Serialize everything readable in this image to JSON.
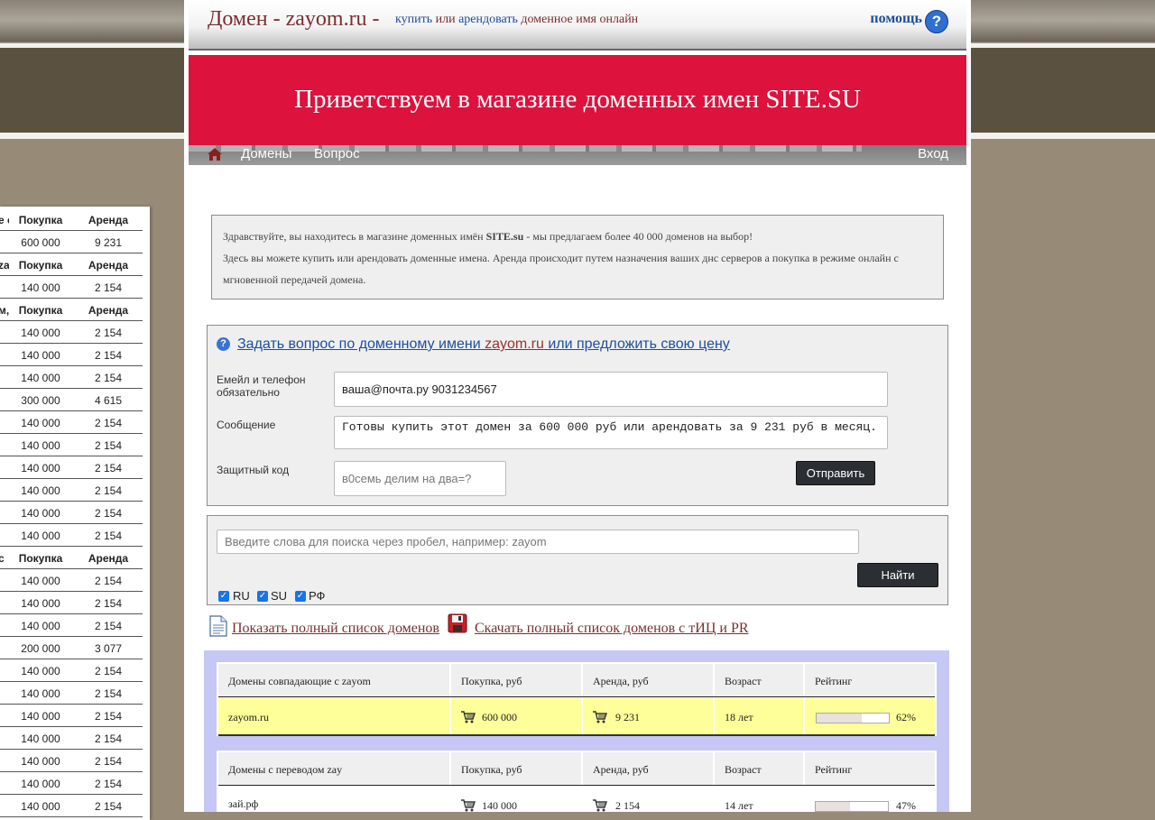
{
  "header": {
    "title": "Домен - zayom.ru -",
    "tagline_buy": "купить",
    "tagline_or": "или",
    "tagline_rent": "арендовать",
    "tagline_rest": "доменное имя онлайн",
    "help_label": "помощь",
    "help_icon": "question-mark-icon"
  },
  "banner": {
    "text": "Приветствуем в магазине доменных имен SITE.SU",
    "color": "#dd123d"
  },
  "nav": {
    "home_icon": "home-icon",
    "items": [
      "Домены",
      "Вопрос"
    ],
    "login": "Вход"
  },
  "intro": {
    "line1_a": "Здравствуйте, вы находитесь в магазине доменных имён",
    "line1_b": "SITE.su",
    "line1_c": "- мы предлагаем более 40 000 доменов на выбор!",
    "line2": "Здесь вы можете купить или арендовать доменные имена. Аренда происходит путем назначения ваших днс серверов а покупка в режиме онлайн с",
    "line3": "мгновенной передачей домена."
  },
  "question_form": {
    "title_a": "Задать вопрос по доменному имени",
    "title_z": "z",
    "title_domain": "ayom.ru",
    "title_b": "или предложить свою цену",
    "email_label": "Емейл и телефон обязательно",
    "email_value": "ваша@почта.ру 9031234567",
    "message_label": "Сообщение",
    "message_value": "Готовы купить этот домен за 600 000 руб или арендовать за 9 231 руб в месяц.",
    "captcha_label": "Защитный код",
    "captcha_placeholder": "в0семь делим на два=?",
    "submit_label": "Отправить"
  },
  "search": {
    "placeholder": "Введите слова для поиска через пробел, например: zayom",
    "button_label": "Найти",
    "zones": [
      {
        "label": "RU",
        "checked": true
      },
      {
        "label": "SU",
        "checked": true
      },
      {
        "label": "РФ",
        "checked": true
      }
    ]
  },
  "links": {
    "full_list": "Показать полный список доменов",
    "download": "Скачать полный список доменов с тИЦ и PR"
  },
  "left_table": {
    "rows": [
      {
        "c0": "е с",
        "c1": "Покупка",
        "c2": "Аренда",
        "header": true
      },
      {
        "c0": "",
        "c1": "600 000",
        "c2": "9 231"
      },
      {
        "c0": "za",
        "c1": "Покупка",
        "c2": "Аренда",
        "header": true
      },
      {
        "c0": "",
        "c1": "140 000",
        "c2": "2 154"
      },
      {
        "c0": "м,",
        "c1": "Покупка",
        "c2": "Аренда",
        "header": true
      },
      {
        "c0": "",
        "c1": "140 000",
        "c2": "2 154"
      },
      {
        "c0": "",
        "c1": "140 000",
        "c2": "2 154"
      },
      {
        "c0": "",
        "c1": "140 000",
        "c2": "2 154"
      },
      {
        "c0": "",
        "c1": "300 000",
        "c2": "4 615"
      },
      {
        "c0": "",
        "c1": "140 000",
        "c2": "2 154"
      },
      {
        "c0": "",
        "c1": "140 000",
        "c2": "2 154"
      },
      {
        "c0": "",
        "c1": "140 000",
        "c2": "2 154"
      },
      {
        "c0": "",
        "c1": "140 000",
        "c2": "2 154"
      },
      {
        "c0": "",
        "c1": "140 000",
        "c2": "2 154"
      },
      {
        "c0": "",
        "c1": "140 000",
        "c2": "2 154"
      },
      {
        "c0": "с",
        "c1": "Покупка",
        "c2": "Аренда",
        "header": true
      },
      {
        "c0": "",
        "c1": "140 000",
        "c2": "2 154"
      },
      {
        "c0": "",
        "c1": "140 000",
        "c2": "2 154"
      },
      {
        "c0": "",
        "c1": "140 000",
        "c2": "2 154"
      },
      {
        "c0": "",
        "c1": "200 000",
        "c2": "3 077"
      },
      {
        "c0": "",
        "c1": "140 000",
        "c2": "2 154"
      },
      {
        "c0": "",
        "c1": "140 000",
        "c2": "2 154"
      },
      {
        "c0": "",
        "c1": "140 000",
        "c2": "2 154"
      },
      {
        "c0": "",
        "c1": "140 000",
        "c2": "2 154"
      },
      {
        "c0": "",
        "c1": "140 000",
        "c2": "2 154"
      },
      {
        "c0": "",
        "c1": "140 000",
        "c2": "2 154"
      },
      {
        "c0": "",
        "c1": "140 000",
        "c2": "2 154"
      }
    ]
  },
  "results": {
    "tables": [
      {
        "columns": [
          "Домены совпадающие с zayom",
          "Покупка, руб",
          "Аренда, руб",
          "Возраст",
          "Рейтинг"
        ],
        "rows": [
          {
            "domain": "zayom.ru",
            "buy": "600 000",
            "rent": "9 231",
            "age": "18 лет",
            "rating": "62%",
            "rating_value": 0.62,
            "highlight": true
          }
        ]
      },
      {
        "columns": [
          "Домены с переводом zay",
          "Покупка, руб",
          "Аренда, руб",
          "Возраст",
          "Рейтинг"
        ],
        "rows": [
          {
            "domain": "зай.рф",
            "buy": "140 000",
            "rent": "2 154",
            "age": "14 лет",
            "rating": "47%",
            "rating_value": 0.47,
            "highlight": false
          }
        ]
      }
    ]
  }
}
